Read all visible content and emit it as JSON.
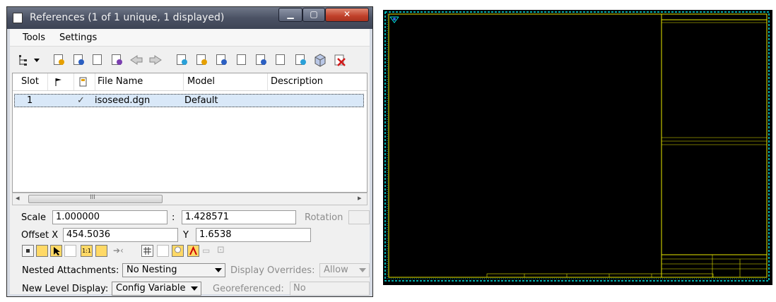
{
  "window": {
    "title": "References (1 of 1 unique, 1 displayed)",
    "minimize_glyph": "▁",
    "maximize_glyph": "▢",
    "close_glyph": "✕"
  },
  "menu": [
    "Tools",
    "Settings"
  ],
  "toolbar": {
    "icons": [
      "list-tree-icon",
      "attach-reference-icon",
      "detach-reference-icon",
      "reload-reference-icon",
      "exchange-reference-icon",
      "move-reference-icon",
      "copy-reference-icon",
      "scale-reference-icon",
      "rotate-reference-icon",
      "mirror-horizontal-icon",
      "mirror-vertical-icon",
      "clip-boundary-icon",
      "clip-mask-icon",
      "clip-delete-icon",
      "clip-front-icon",
      "clip-back-icon",
      "3d-box-icon",
      "delete-reference-icon"
    ]
  },
  "table": {
    "columns": [
      "Slot",
      "",
      "",
      "File Name",
      "Model",
      "Description"
    ],
    "rows": [
      {
        "slot": "1",
        "check": "✓",
        "file": "isoseed.dgn",
        "model": "Default",
        "description": ""
      }
    ]
  },
  "scrollbar": {
    "left_arrow": "◂",
    "grip": "III",
    "right_arrow": "▸"
  },
  "props": {
    "scale_label": "Scale",
    "scale_x": "1.000000",
    "scale_sep": ":",
    "scale_y": "1.428571",
    "rotation_label": "Rotation",
    "offset_label": "Offset X",
    "offset_x": "454.5036",
    "y_label": "Y",
    "offset_y": "1.6538"
  },
  "options": {
    "nested_label": "Nested Attachments:",
    "nested_value": "No Nesting",
    "overrides_label": "Display Overrides:",
    "overrides_value": "Allow",
    "level_label": "New Level Display:",
    "level_value": "Config Variable",
    "geo_label": "Georeferenced:",
    "geo_value": "No"
  },
  "settings_icons": [
    "display-icon",
    "snap-icon",
    "locate-icon",
    "treat-as-element-icon",
    "true-scale-icon",
    "scale-line-styles-icon",
    "display-raster-icon",
    "level-symbology-icon",
    "ignore-attach-icon",
    "use-lights-icon",
    "annotation-scale-icon",
    "tooltip-icon",
    "lock-icon"
  ],
  "colors": {
    "drawing_bg": "#000000",
    "border_cyan": "#00e5e5",
    "frame_yellow": "#e8e800",
    "selection": "#d9e8f8"
  }
}
